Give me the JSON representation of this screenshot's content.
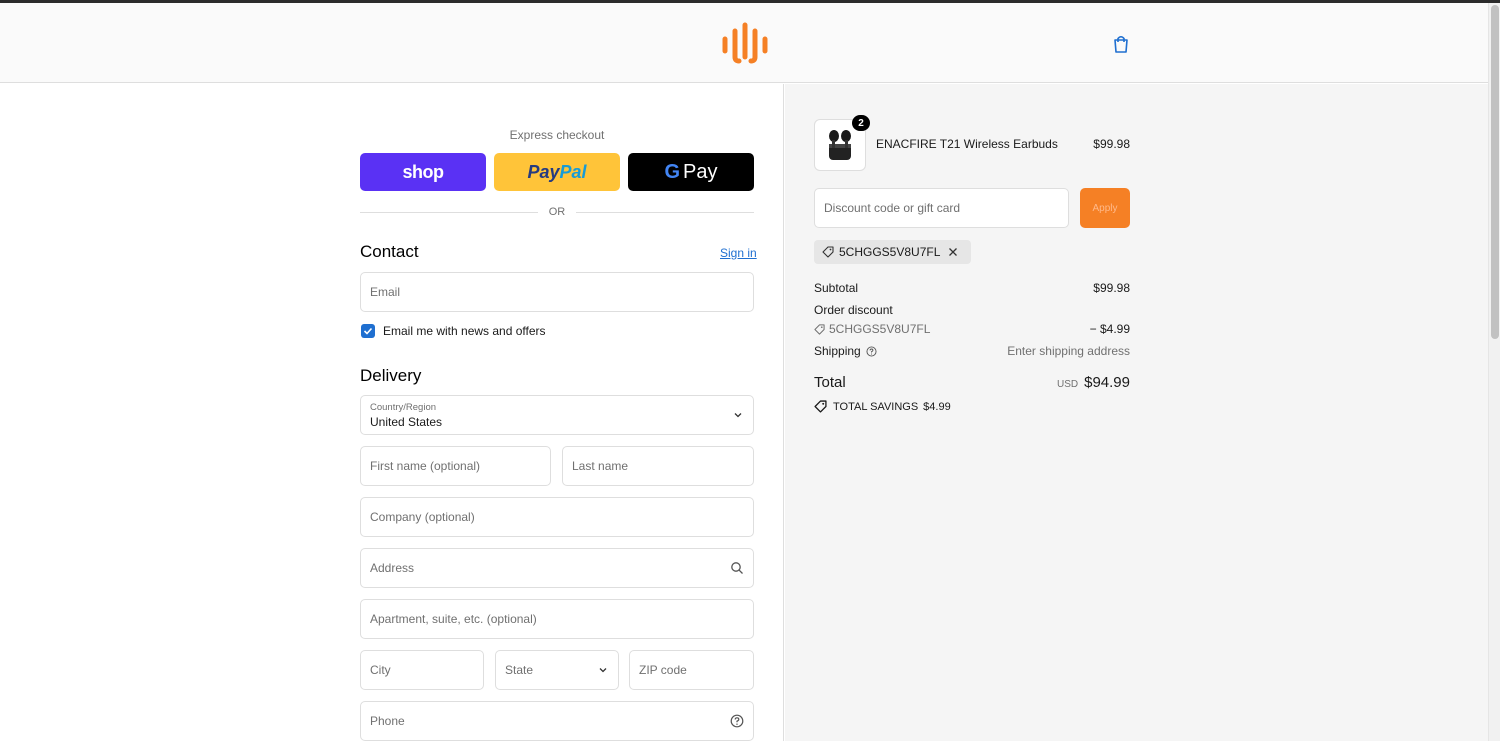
{
  "colors": {
    "brand_orange": "#f58025",
    "link_blue": "#1f6fd0",
    "shop_purple": "#5a31f4",
    "paypal_yellow": "#ffc439"
  },
  "header": {
    "logo_icon": "brand-logo-icon",
    "cart_icon": "shopping-bag-icon"
  },
  "express": {
    "label": "Express checkout",
    "shop_label": "shop",
    "paypal_label_1": "Pay",
    "paypal_label_2": "Pal",
    "gpay_g": "G",
    "gpay_label": "Pay",
    "or_label": "OR"
  },
  "contact": {
    "title": "Contact",
    "signin_label": "Sign in",
    "email_placeholder": "Email",
    "newsletter_label": "Email me with news and offers",
    "newsletter_checked": true
  },
  "delivery": {
    "title": "Delivery",
    "country_label": "Country/Region",
    "country_value": "United States",
    "first_name_placeholder": "First name (optional)",
    "last_name_placeholder": "Last name",
    "company_placeholder": "Company (optional)",
    "address_placeholder": "Address",
    "apartment_placeholder": "Apartment, suite, etc. (optional)",
    "city_placeholder": "City",
    "state_placeholder": "State",
    "zip_placeholder": "ZIP code",
    "phone_placeholder": "Phone"
  },
  "summary": {
    "product_name": "ENACFIRE T21 Wireless Earbuds",
    "product_qty": "2",
    "product_price": "$99.98",
    "discount_placeholder": "Discount code or gift card",
    "apply_label": "Apply",
    "applied_code": "5CHGGS5V8U7FL",
    "subtotal_label": "Subtotal",
    "subtotal_value": "$99.98",
    "order_discount_label": "Order discount",
    "discount_code_line": "5CHGGS5V8U7FL",
    "discount_value": "− $4.99",
    "shipping_label": "Shipping",
    "shipping_value": "Enter shipping address",
    "total_label": "Total",
    "currency": "USD",
    "total_value": "$94.99",
    "savings_label": "TOTAL SAVINGS",
    "savings_value": "$4.99"
  }
}
